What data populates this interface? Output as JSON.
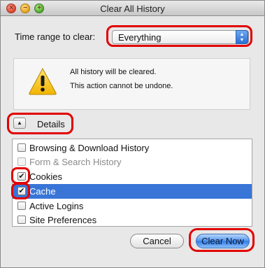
{
  "window": {
    "title": "Clear All History"
  },
  "time_range": {
    "label": "Time range to clear:",
    "selected": "Everything"
  },
  "warning": {
    "line1": "All history will be cleared.",
    "line2": "This action cannot be undone."
  },
  "details": {
    "label": "Details",
    "expanded": true
  },
  "items": [
    {
      "label": "Browsing & Download History",
      "checked": false,
      "disabled": false,
      "selected": false
    },
    {
      "label": "Form & Search History",
      "checked": false,
      "disabled": true,
      "selected": false
    },
    {
      "label": "Cookies",
      "checked": true,
      "disabled": false,
      "selected": false
    },
    {
      "label": "Cache",
      "checked": true,
      "disabled": false,
      "selected": true
    },
    {
      "label": "Active Logins",
      "checked": false,
      "disabled": false,
      "selected": false
    },
    {
      "label": "Site Preferences",
      "checked": false,
      "disabled": false,
      "selected": false
    }
  ],
  "buttons": {
    "cancel": "Cancel",
    "clear_now": "Clear Now"
  },
  "colors": {
    "highlight": "#e20000",
    "selection": "#3875d7",
    "default_button": "#2f7be6"
  },
  "icons": {
    "close": "close-icon",
    "minimize": "minimize-icon",
    "maximize": "maximize-icon",
    "warning": "warning-icon",
    "disclosure": "disclosure-up-icon",
    "stepper": "updown-stepper-icon"
  }
}
